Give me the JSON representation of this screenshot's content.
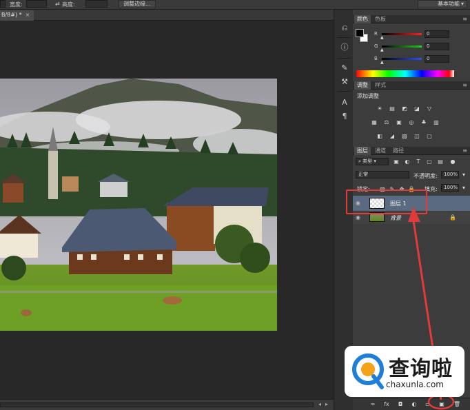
{
  "option_bar": {
    "width_label": "宽度:",
    "height_label": "高度:",
    "refine_edge_button": "调整边缘...",
    "workspace": "基本功能"
  },
  "document": {
    "tab_label": "B/8#) *",
    "close_glyph": "×"
  },
  "panels": {
    "color": {
      "tabs": [
        "颜色",
        "色板"
      ],
      "channels": [
        {
          "name": "R",
          "value": "0",
          "color": "#d03030"
        },
        {
          "name": "G",
          "value": "0",
          "color": "#30b030"
        },
        {
          "name": "B",
          "value": "0",
          "color": "#3050e0"
        }
      ]
    },
    "adjustments": {
      "tabs": [
        "调整",
        "样式"
      ],
      "title": "添加调整",
      "row1": [
        "☀",
        "▤",
        "◩",
        "◪",
        "▽"
      ],
      "row2": [
        "▦",
        "⚖",
        "▣",
        "◎",
        "♣",
        "▥"
      ],
      "row3": [
        "◧",
        "◢",
        "▨",
        "◫",
        "▢"
      ]
    },
    "layers": {
      "tabs": [
        "图层",
        "通道",
        "路径"
      ],
      "filter": "类型",
      "blend_mode": "正常",
      "opacity_label": "不透明度:",
      "opacity_value": "100%",
      "lock_label": "锁定:",
      "fill_label": "填充:",
      "fill_value": "100%",
      "items": [
        {
          "name": "图层 1",
          "selected": true
        },
        {
          "name": "背景",
          "selected": false
        }
      ],
      "footer_icons": [
        "∞",
        "fx",
        "◘",
        "◐",
        "▭",
        "▣",
        "🗑"
      ]
    }
  },
  "watermark": {
    "brand": "查询啦",
    "url": "chaxunla.com"
  },
  "colors": {
    "annotation_red": "#e03a3a",
    "layer_selected": "#5a6a80"
  },
  "tool_icons": [
    "history-icon",
    "info-icon",
    "brush-icon",
    "clone-icon",
    "character-icon",
    "paragraph-icon"
  ]
}
